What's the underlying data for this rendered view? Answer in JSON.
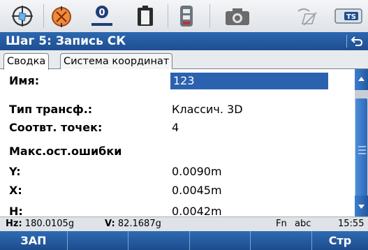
{
  "title": "Шаг 5: Запись СК",
  "tabs": [
    {
      "label": "Сводка",
      "active": true
    },
    {
      "label": "Система координат",
      "active": false
    }
  ],
  "fields": {
    "name_label": "Имя:",
    "name_value": "123",
    "transform_label": "Тип трансф.:",
    "transform_value": "Классич. 3D",
    "points_label": "Соотвт. точек:",
    "points_value": "4",
    "max_errors_heading": "Макс.ост.ошибки",
    "y_label": "Y:",
    "y_value": "0.0090m",
    "x_label": "X:",
    "x_value": "0.0045m",
    "h_label": "H:",
    "h_value": "0.0042m"
  },
  "status": {
    "hz_label": "Hz:",
    "hz_value": "180.0105g",
    "v_label": "V:",
    "v_value": "82.1687g",
    "fn": "Fn",
    "input_mode": "abc",
    "time": "15:55"
  },
  "iconbar": {
    "prism_constant": "0",
    "ts_badge": "TS"
  },
  "softkeys": {
    "f1": "ЗАП",
    "f2": "",
    "f3": "",
    "f4": "",
    "f5": "",
    "f6": "Стр"
  },
  "colors": {
    "title_bar": "#2459a1",
    "selection": "#2b62b0",
    "softkey_bar": "#245ca3"
  },
  "icons": [
    "target-prism-icon",
    "laser-pointer-icon",
    "prism-constant-icon",
    "battery-icon",
    "memory-icon",
    "camera-icon",
    "no-connection-icon",
    "ts-badge-icon",
    "back-icon",
    "scroll-up-icon",
    "scroll-down-icon"
  ]
}
